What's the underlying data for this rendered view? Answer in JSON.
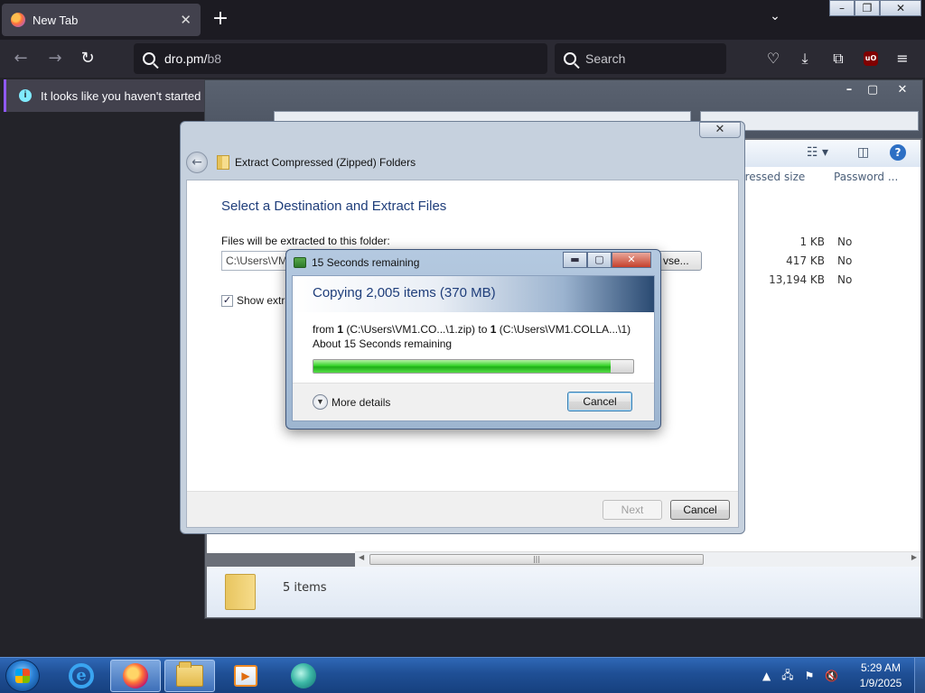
{
  "firefox": {
    "tab_title": "New Tab",
    "tab_close": "✕",
    "new_tab": "+",
    "list_tabs": "⌄",
    "url": "dro.pm/",
    "url_path": "b8",
    "search_placeholder": "Search",
    "notification": "It looks like you haven't started Fir",
    "ublock_label": "uO",
    "window_controls": {
      "min": "–",
      "restore": "❐",
      "close": "✕"
    }
  },
  "explorer": {
    "controls": {
      "min": "–",
      "max": "▢",
      "close": "✕"
    },
    "columns": [
      "pressed size",
      "Password ..."
    ],
    "rows": [
      {
        "size": "1 KB",
        "password": "No"
      },
      {
        "size": "417 KB",
        "password": "No"
      },
      {
        "size": "13,194 KB",
        "password": "No"
      }
    ],
    "status_count": "5 items"
  },
  "extract_dialog": {
    "close": "✕",
    "title": "Extract Compressed (Zipped) Folders",
    "heading": "Select a Destination and Extract Files",
    "label": "Files will be extracted to this folder:",
    "path_value": "C:\\Users\\VM",
    "browse_label": "vse...",
    "show_label": "Show extra",
    "show_checked": true,
    "next_label": "Next",
    "cancel_label": "Cancel"
  },
  "copy_dialog": {
    "title": "15 Seconds remaining",
    "heading": "Copying 2,005 items (370 MB)",
    "from_prefix": "from ",
    "from_name": "1",
    "from_path": " (C:\\Users\\VM1.CO...\\1.zip)  to ",
    "to_name": "1",
    "to_path": " (C:\\Users\\VM1.COLLA...\\1)",
    "remaining": "About 15 Seconds remaining",
    "progress": 0.93,
    "more_details": "More details",
    "cancel_label": "Cancel"
  },
  "taskbar": {
    "time": "5:29 AM",
    "date": "1/9/2025",
    "apps": [
      "internet-explorer-icon",
      "firefox-icon",
      "explorer-folder-icon",
      "media-player-icon",
      "app-icon"
    ]
  }
}
